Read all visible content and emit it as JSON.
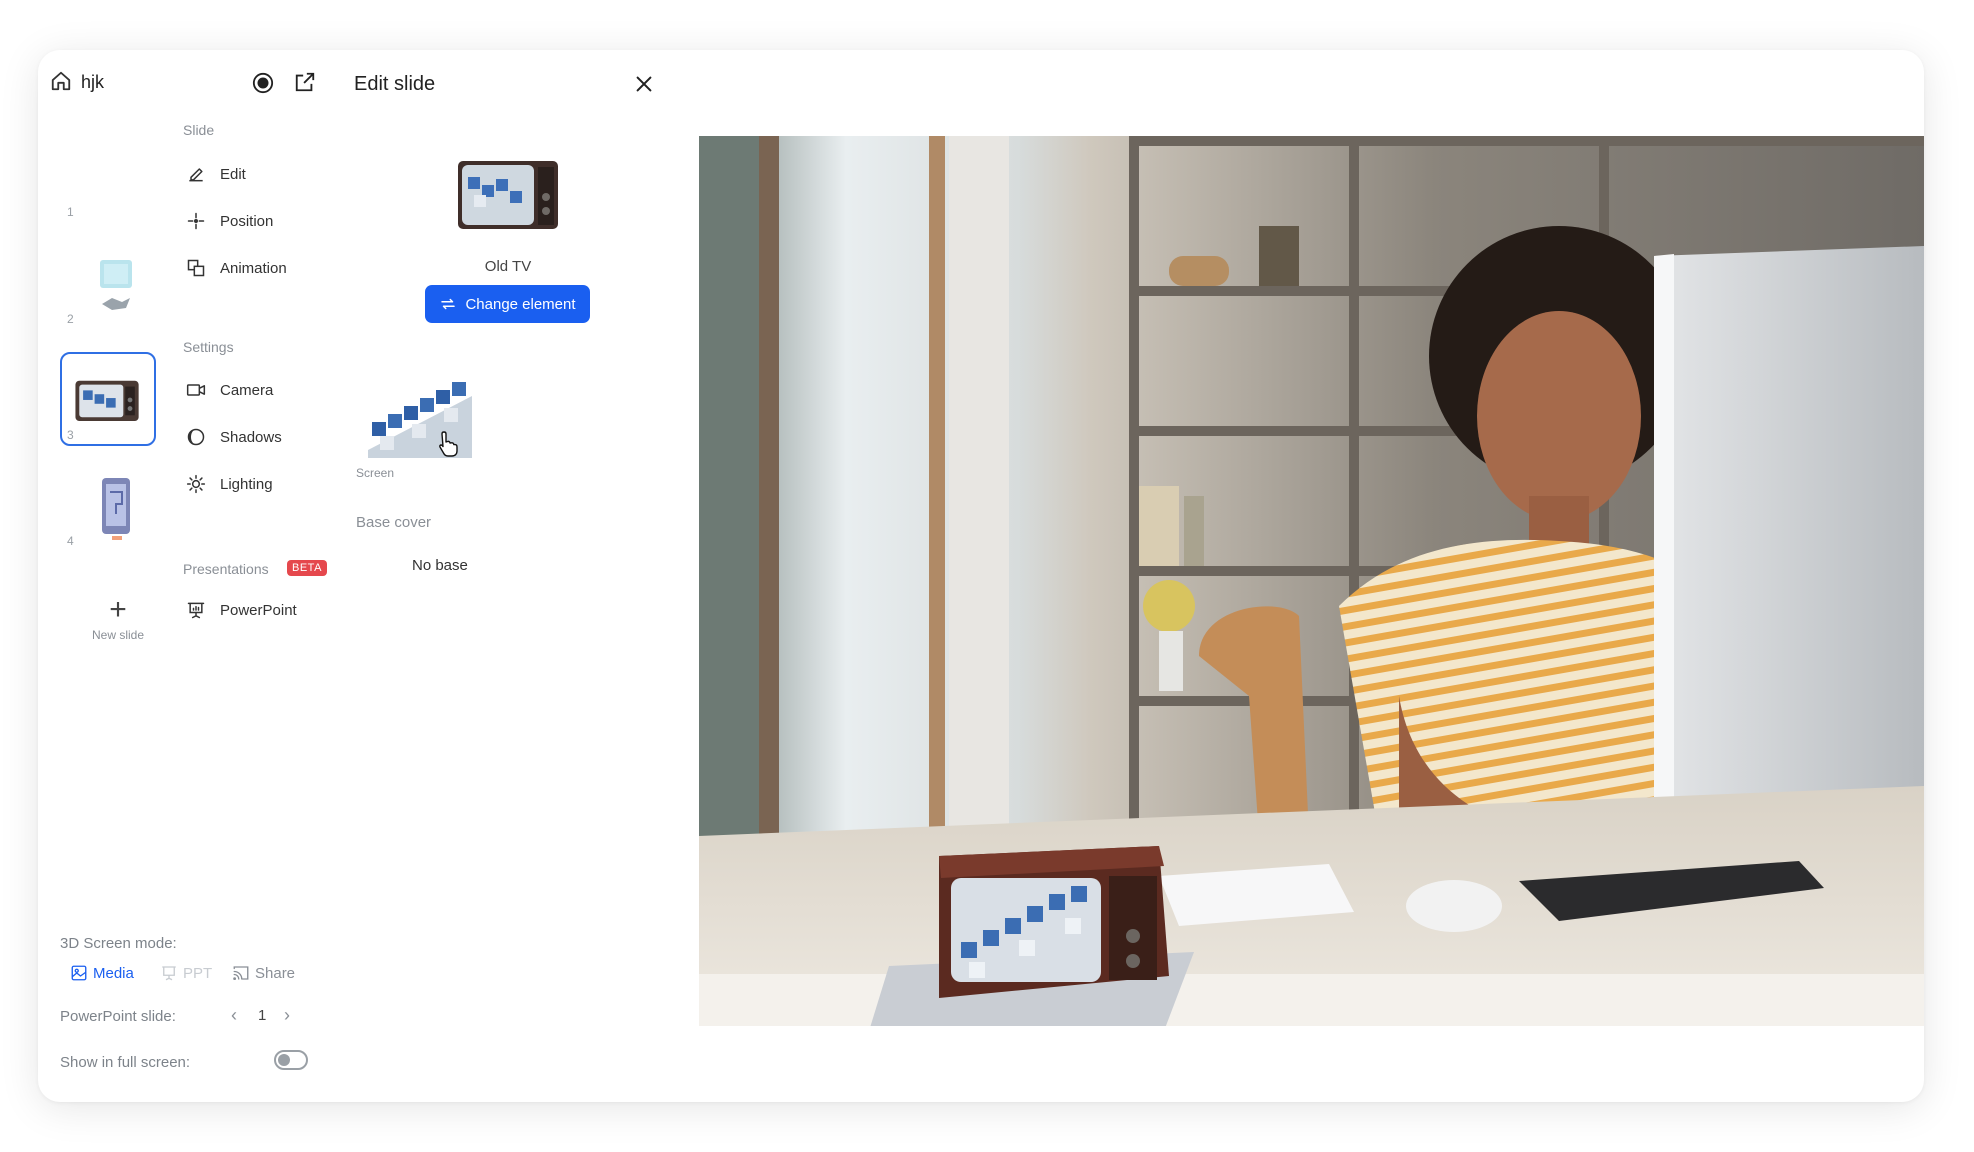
{
  "project": {
    "name": "hjk"
  },
  "panel": {
    "title": "Edit slide"
  },
  "slides": [
    {
      "number": "1"
    },
    {
      "number": "2"
    },
    {
      "number": "3"
    },
    {
      "number": "4"
    }
  ],
  "new_slide_label": "New slide",
  "menu": {
    "slide_section": "Slide",
    "edit": "Edit",
    "position": "Position",
    "animation": "Animation",
    "settings_section": "Settings",
    "camera": "Camera",
    "shadows": "Shadows",
    "lighting": "Lighting",
    "presentations_section": "Presentations",
    "beta_badge": "BETA",
    "powerpoint": "PowerPoint"
  },
  "element": {
    "name": "Old TV",
    "change_button": "Change element",
    "screen_label": "Screen",
    "base_cover_label": "Base cover",
    "base_value": "No base"
  },
  "screen_mode": {
    "label": "3D Screen mode:",
    "media": "Media",
    "ppt": "PPT",
    "share": "Share",
    "selected": "Media"
  },
  "powerpoint_slide": {
    "label": "PowerPoint slide:",
    "value": "1"
  },
  "fullscreen": {
    "label": "Show in full screen:",
    "enabled": false
  },
  "colors": {
    "accent": "#1a5ff0",
    "selected_border": "#2f6fe4",
    "beta": "#e5484d"
  },
  "icons": [
    "home-icon",
    "record-icon",
    "external-link-icon",
    "close-icon",
    "edit-icon",
    "position-icon",
    "animation-icon",
    "camera-icon",
    "shadows-icon",
    "lighting-icon",
    "powerpoint-icon",
    "change-icon",
    "media-icon",
    "ppt-icon",
    "share-icon",
    "pointer-cursor-icon"
  ]
}
